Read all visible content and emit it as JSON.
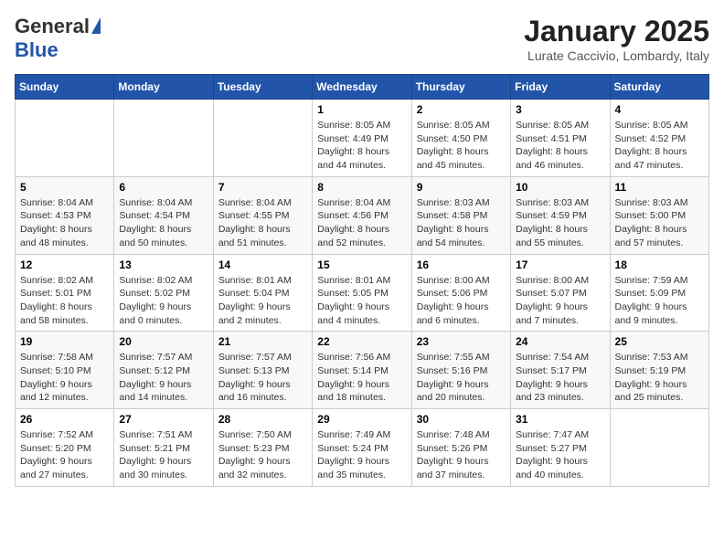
{
  "header": {
    "logo_general": "General",
    "logo_blue": "Blue",
    "month_title": "January 2025",
    "location": "Lurate Caccivio, Lombardy, Italy"
  },
  "weekdays": [
    "Sunday",
    "Monday",
    "Tuesday",
    "Wednesday",
    "Thursday",
    "Friday",
    "Saturday"
  ],
  "weeks": [
    [
      {
        "day": "",
        "info": ""
      },
      {
        "day": "",
        "info": ""
      },
      {
        "day": "",
        "info": ""
      },
      {
        "day": "1",
        "info": "Sunrise: 8:05 AM\nSunset: 4:49 PM\nDaylight: 8 hours\nand 44 minutes."
      },
      {
        "day": "2",
        "info": "Sunrise: 8:05 AM\nSunset: 4:50 PM\nDaylight: 8 hours\nand 45 minutes."
      },
      {
        "day": "3",
        "info": "Sunrise: 8:05 AM\nSunset: 4:51 PM\nDaylight: 8 hours\nand 46 minutes."
      },
      {
        "day": "4",
        "info": "Sunrise: 8:05 AM\nSunset: 4:52 PM\nDaylight: 8 hours\nand 47 minutes."
      }
    ],
    [
      {
        "day": "5",
        "info": "Sunrise: 8:04 AM\nSunset: 4:53 PM\nDaylight: 8 hours\nand 48 minutes."
      },
      {
        "day": "6",
        "info": "Sunrise: 8:04 AM\nSunset: 4:54 PM\nDaylight: 8 hours\nand 50 minutes."
      },
      {
        "day": "7",
        "info": "Sunrise: 8:04 AM\nSunset: 4:55 PM\nDaylight: 8 hours\nand 51 minutes."
      },
      {
        "day": "8",
        "info": "Sunrise: 8:04 AM\nSunset: 4:56 PM\nDaylight: 8 hours\nand 52 minutes."
      },
      {
        "day": "9",
        "info": "Sunrise: 8:03 AM\nSunset: 4:58 PM\nDaylight: 8 hours\nand 54 minutes."
      },
      {
        "day": "10",
        "info": "Sunrise: 8:03 AM\nSunset: 4:59 PM\nDaylight: 8 hours\nand 55 minutes."
      },
      {
        "day": "11",
        "info": "Sunrise: 8:03 AM\nSunset: 5:00 PM\nDaylight: 8 hours\nand 57 minutes."
      }
    ],
    [
      {
        "day": "12",
        "info": "Sunrise: 8:02 AM\nSunset: 5:01 PM\nDaylight: 8 hours\nand 58 minutes."
      },
      {
        "day": "13",
        "info": "Sunrise: 8:02 AM\nSunset: 5:02 PM\nDaylight: 9 hours\nand 0 minutes."
      },
      {
        "day": "14",
        "info": "Sunrise: 8:01 AM\nSunset: 5:04 PM\nDaylight: 9 hours\nand 2 minutes."
      },
      {
        "day": "15",
        "info": "Sunrise: 8:01 AM\nSunset: 5:05 PM\nDaylight: 9 hours\nand 4 minutes."
      },
      {
        "day": "16",
        "info": "Sunrise: 8:00 AM\nSunset: 5:06 PM\nDaylight: 9 hours\nand 6 minutes."
      },
      {
        "day": "17",
        "info": "Sunrise: 8:00 AM\nSunset: 5:07 PM\nDaylight: 9 hours\nand 7 minutes."
      },
      {
        "day": "18",
        "info": "Sunrise: 7:59 AM\nSunset: 5:09 PM\nDaylight: 9 hours\nand 9 minutes."
      }
    ],
    [
      {
        "day": "19",
        "info": "Sunrise: 7:58 AM\nSunset: 5:10 PM\nDaylight: 9 hours\nand 12 minutes."
      },
      {
        "day": "20",
        "info": "Sunrise: 7:57 AM\nSunset: 5:12 PM\nDaylight: 9 hours\nand 14 minutes."
      },
      {
        "day": "21",
        "info": "Sunrise: 7:57 AM\nSunset: 5:13 PM\nDaylight: 9 hours\nand 16 minutes."
      },
      {
        "day": "22",
        "info": "Sunrise: 7:56 AM\nSunset: 5:14 PM\nDaylight: 9 hours\nand 18 minutes."
      },
      {
        "day": "23",
        "info": "Sunrise: 7:55 AM\nSunset: 5:16 PM\nDaylight: 9 hours\nand 20 minutes."
      },
      {
        "day": "24",
        "info": "Sunrise: 7:54 AM\nSunset: 5:17 PM\nDaylight: 9 hours\nand 23 minutes."
      },
      {
        "day": "25",
        "info": "Sunrise: 7:53 AM\nSunset: 5:19 PM\nDaylight: 9 hours\nand 25 minutes."
      }
    ],
    [
      {
        "day": "26",
        "info": "Sunrise: 7:52 AM\nSunset: 5:20 PM\nDaylight: 9 hours\nand 27 minutes."
      },
      {
        "day": "27",
        "info": "Sunrise: 7:51 AM\nSunset: 5:21 PM\nDaylight: 9 hours\nand 30 minutes."
      },
      {
        "day": "28",
        "info": "Sunrise: 7:50 AM\nSunset: 5:23 PM\nDaylight: 9 hours\nand 32 minutes."
      },
      {
        "day": "29",
        "info": "Sunrise: 7:49 AM\nSunset: 5:24 PM\nDaylight: 9 hours\nand 35 minutes."
      },
      {
        "day": "30",
        "info": "Sunrise: 7:48 AM\nSunset: 5:26 PM\nDaylight: 9 hours\nand 37 minutes."
      },
      {
        "day": "31",
        "info": "Sunrise: 7:47 AM\nSunset: 5:27 PM\nDaylight: 9 hours\nand 40 minutes."
      },
      {
        "day": "",
        "info": ""
      }
    ]
  ]
}
